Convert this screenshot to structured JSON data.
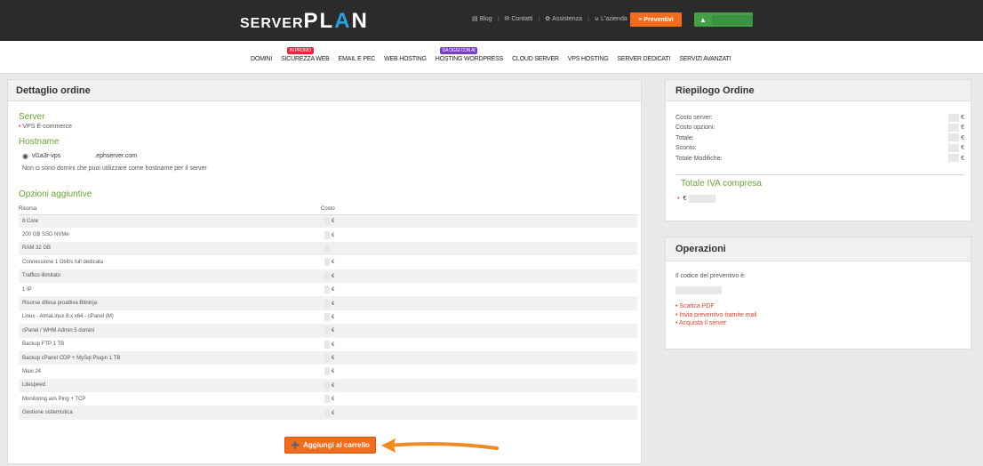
{
  "topbar": {
    "logo_a": "SERVER",
    "logo_b": "PL",
    "logo_accent": "A",
    "logo_c": "N",
    "links": [
      {
        "icon": "rss-icon",
        "glyph": "▤",
        "label": "Blog"
      },
      {
        "icon": "mail-icon",
        "glyph": "✉",
        "label": "Contatti"
      },
      {
        "icon": "gear-icon",
        "glyph": "✿",
        "label": "Assistenza"
      },
      {
        "icon": "cart-icon",
        "glyph": "⊌",
        "label": "L'azienda"
      }
    ],
    "preventivi_label": "≡ Preventivi",
    "user_glyph": "▲"
  },
  "nav": {
    "items": [
      "DOMINI",
      "SICUREZZA WEB",
      "EMAIL E PEC",
      "WEB HOSTING",
      "HOSTING WORDPRESS",
      "CLOUD SERVER",
      "VPS HOSTING",
      "SERVER DEDICATI",
      "SERVIZI AVANZATI"
    ],
    "badge_red": "IN PROMO",
    "badge_purple": "DA OGGI CON AI"
  },
  "order": {
    "title": "Dettaglio ordine",
    "server_title": "Server",
    "server_value": "VPS E-commerce",
    "hostname_title": "Hostname",
    "hostname_prefix": "vl1a3r-vps",
    "hostname_suffix": ".ephserver.com",
    "hostname_note": "Non ci sono domini che puoi utilizzare come hostname per il server",
    "options_title": "Opzioni aggiuntive",
    "col_resource": "Risorsa",
    "col_cost": "Costo",
    "rows": [
      {
        "name": "8 Core",
        "cost": "€"
      },
      {
        "name": "200 GB SSD NVMe",
        "cost": "€"
      },
      {
        "name": "RAM 32 GB",
        "cost": ""
      },
      {
        "name": "Connessione 1 Gbit/s full dedicata",
        "cost": "€"
      },
      {
        "name": "Traffico illimitato",
        "cost": "€"
      },
      {
        "name": "1 IP",
        "cost": "€"
      },
      {
        "name": "Risorse difesa proattiva Bitninja",
        "cost": "€"
      },
      {
        "name": "Linux - AlmaLinux 8.x x64 - cPanel (M)",
        "cost": "€"
      },
      {
        "name": "cPanel / WHM Admin 5 domini",
        "cost": "€"
      },
      {
        "name": "Backup FTP 1 TB",
        "cost": "€"
      },
      {
        "name": "Backup cPanel CDP + MySql Plugin 1 TB",
        "cost": "€"
      },
      {
        "name": "Maxi 24",
        "cost": "€"
      },
      {
        "name": "Litespeed",
        "cost": "€"
      },
      {
        "name": "Monitoring avs Ping + TCP",
        "cost": "€"
      },
      {
        "name": "Gestione sistemistica",
        "cost": "€"
      }
    ],
    "cart_button": "Aggiungi al carrello"
  },
  "summary": {
    "title": "Riepilogo Ordine",
    "lines": [
      {
        "label": "Costo server:",
        "value": "€"
      },
      {
        "label": "Costo opzioni:",
        "value": "€"
      },
      {
        "label": "Totale:",
        "value": "€"
      },
      {
        "label": "Sconto:",
        "value": "€"
      },
      {
        "label": "Totale Modifiche:",
        "value": "€"
      }
    ],
    "iva_title": "Totale IVA compresa",
    "iva_value": "€"
  },
  "ops": {
    "title": "Operazioni",
    "quote_label": "Il codice del preventivo è:",
    "actions": [
      "Scarica PDF",
      "Invia preventivo tramite mail",
      "Acquista il server"
    ]
  }
}
